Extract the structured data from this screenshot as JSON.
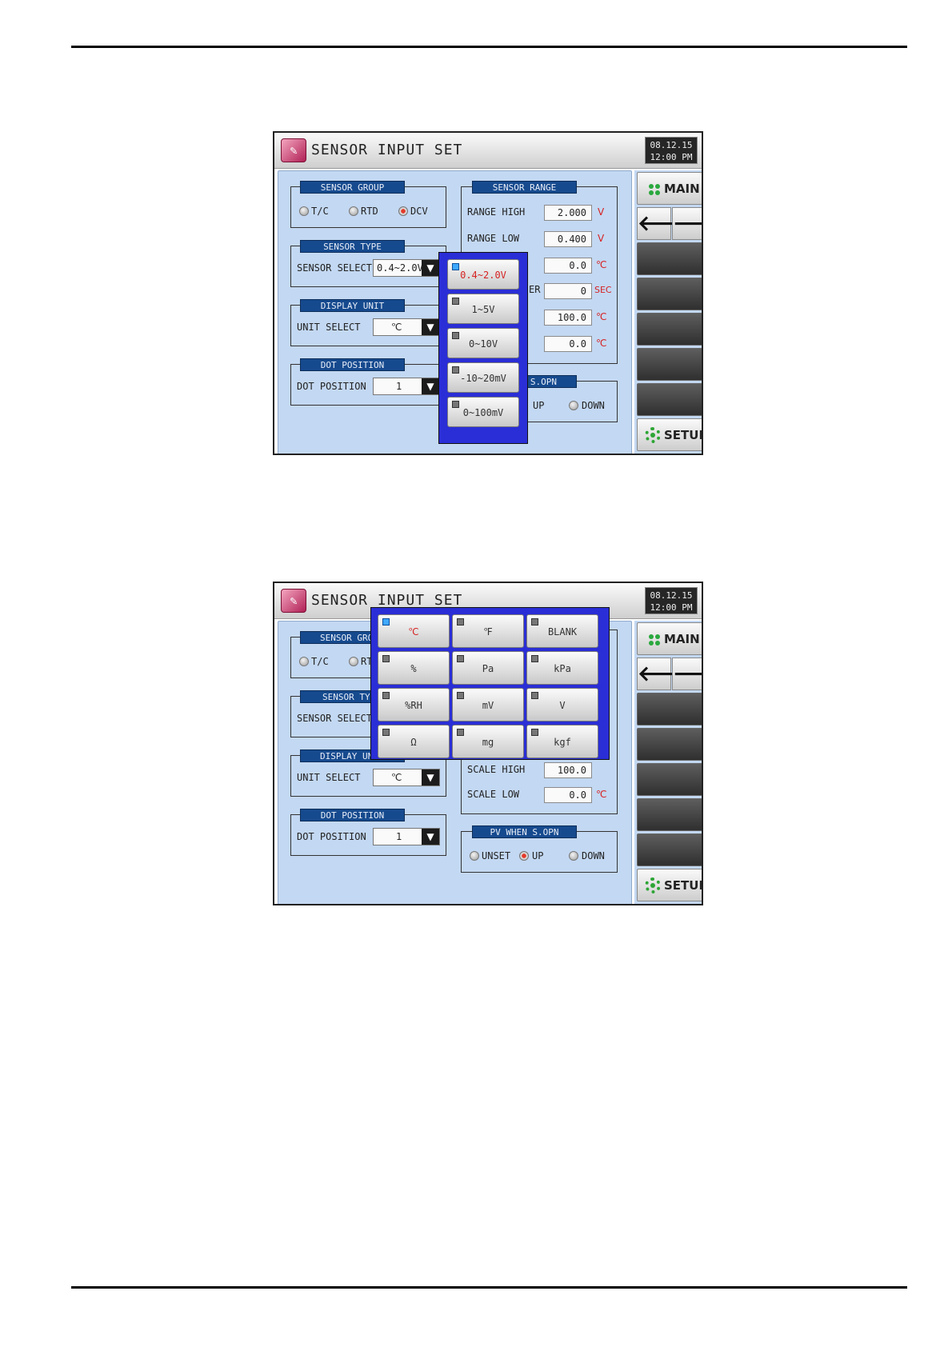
{
  "screen1": {
    "title": "SENSOR INPUT SET",
    "date": "08.12.15",
    "time": "12:00 PM",
    "side": {
      "main_label": "MAIN",
      "setup_label": "SETUP",
      "back_glyph": "🡐",
      "forward_glyph": "🡒"
    },
    "sensor_group": {
      "header": "SENSOR GROUP",
      "options": [
        "T/C",
        "RTD",
        "DCV"
      ],
      "selected": "DCV"
    },
    "sensor_type": {
      "header": "SENSOR TYPE",
      "label": "SENSOR SELECT",
      "value": "0.4~2.0V"
    },
    "display_unit": {
      "header": "DISPLAY UNIT",
      "label": "UNIT SELECT",
      "value": "℃"
    },
    "dot_position": {
      "header": "DOT POSITION",
      "label": "DOT POSITION",
      "value": "1"
    },
    "sensor_range": {
      "header": "SENSOR RANGE",
      "range_high_label": "RANGE HIGH",
      "range_high": "2.000",
      "range_high_unit": "V",
      "range_low_label": "RANGE LOW",
      "range_low": "0.400",
      "range_low_unit": "V",
      "row3_value": "0.0",
      "row3_unit": "℃",
      "row4_label_fragment": "ER",
      "row4_value": "0",
      "row4_unit": "SEC",
      "row5_value": "100.0",
      "row5_unit": "℃",
      "row6_value": "0.0",
      "row6_unit": "℃"
    },
    "pv_when": {
      "header_fragment": "S.OPN",
      "option_up": "UP",
      "option_down": "DOWN"
    },
    "popup_options": [
      "0.4~2.0V",
      "1~5V",
      "0~10V",
      "-10~20mV",
      "0~100mV"
    ],
    "popup_selected_index": 0
  },
  "screen2": {
    "title": "SENSOR INPUT SET",
    "date": "08.12.15",
    "time": "12:00 PM",
    "side": {
      "main_label": "MAIN",
      "setup_label": "SETUP",
      "back_glyph": "🡐",
      "forward_glyph": "🡒"
    },
    "sensor_group": {
      "header": "SENSOR GRO",
      "option1": "T/C",
      "option2": "RT"
    },
    "sensor_type": {
      "header": "SENSOR TY",
      "label": "SENSOR SELECT"
    },
    "display_unit": {
      "header": "DISPLAY UN",
      "label": "UNIT SELECT",
      "value": "℃"
    },
    "dot_position": {
      "header": "DOT POSITION",
      "label": "DOT POSITION",
      "value": "1"
    },
    "scale": {
      "partial_label": "SCALE HIGH",
      "partial_value": "100.0",
      "scale_low_label": "SCALE LOW",
      "scale_low": "0.0",
      "scale_low_unit": "℃"
    },
    "pv_when": {
      "header": "PV WHEN S.OPN",
      "options": [
        "UNSET",
        "UP",
        "DOWN"
      ],
      "selected": "UP"
    },
    "unit_options": [
      "℃",
      "℉",
      "BLANK",
      "%",
      "Pa",
      "kPa",
      "%RH",
      "mV",
      "V",
      "Ω",
      "mg",
      "kgf"
    ],
    "unit_selected_index": 0
  }
}
